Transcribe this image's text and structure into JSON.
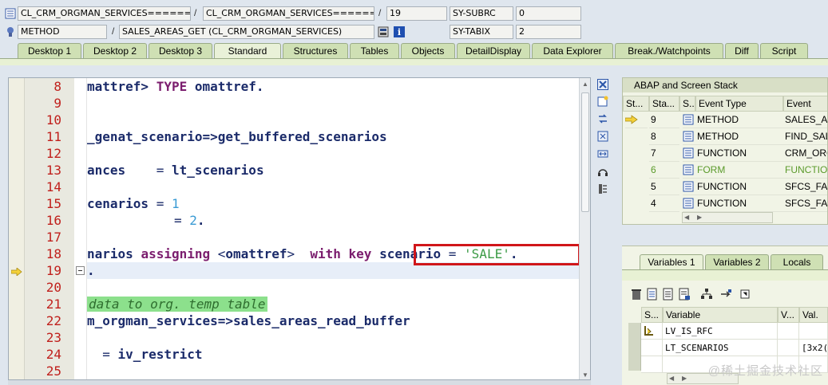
{
  "header": {
    "row1": {
      "field1": "CL_CRM_ORGMAN_SERVICES=======...",
      "sep1": "/",
      "field2": "CL_CRM_ORGMAN_SERVICES=======...",
      "sep2": "/",
      "line_no": "19",
      "sysvar_name": "SY-SUBRC",
      "sysvar_value": "0"
    },
    "row2": {
      "event_type": "METHOD",
      "sep1": "/",
      "event_name": "SALES_AREAS_GET (CL_CRM_ORGMAN_SERVICES)",
      "sysvar_name": "SY-TABIX",
      "sysvar_value": "2"
    }
  },
  "tabs": [
    "Desktop 1",
    "Desktop 2",
    "Desktop 3",
    "Standard",
    "Structures",
    "Tables",
    "Objects",
    "DetailDisplay",
    "Data Explorer",
    "Break./Watchpoints",
    "Diff",
    "Script"
  ],
  "active_tab": "Standard",
  "editor": {
    "lines": [
      {
        "n": "8"
      },
      {
        "n": "9"
      },
      {
        "n": "10"
      },
      {
        "n": "11"
      },
      {
        "n": "12"
      },
      {
        "n": "13"
      },
      {
        "n": "14"
      },
      {
        "n": "15"
      },
      {
        "n": "16"
      },
      {
        "n": "17"
      },
      {
        "n": "18"
      },
      {
        "n": "19"
      },
      {
        "n": "20"
      },
      {
        "n": "21"
      },
      {
        "n": "22"
      },
      {
        "n": "23"
      },
      {
        "n": "24"
      },
      {
        "n": "25"
      }
    ],
    "code": {
      "l8_a": "mattref> ",
      "l8_kw": "TYPE",
      "l8_b": " omattref.",
      "l11": "_genat_scenario=>get_buffered_scenarios",
      "l13_a": "ances    ",
      "l13_op": "=",
      "l13_b": " lt_scenarios",
      "l15_a": "cenarios ",
      "l15_op": "=",
      "l15_num": " 1",
      "l16_op": "=",
      "l16_num": " 2",
      "l16_dot": ".",
      "l18_a": "narios ",
      "l18_kw1": "assigning",
      "l18_lt": " <",
      "l18_b": "omattref",
      "l18_gt": ">",
      "l18_kw2": "  with key",
      "l18_c": " scenario ",
      "l18_op": "=",
      "l18_str": " 'SALE'",
      "l18_dot": ".",
      "l19": ".",
      "l21_cmt": "data to org. temp table",
      "l22": "m_orgman_services=>sales_areas_read_buffer",
      "l24_op": "  =",
      "l24_b": " iv_restrict"
    }
  },
  "stack": {
    "title": "ABAP and Screen Stack",
    "headers": [
      "St...",
      "Sta...",
      "S...",
      "Event Type",
      "Event"
    ],
    "rows": [
      {
        "status": "current",
        "level": "9",
        "type": "METHOD",
        "event": "SALES_AR",
        "color": "#000000"
      },
      {
        "status": "",
        "level": "8",
        "type": "METHOD",
        "event": "FIND_SAL",
        "color": "#000000"
      },
      {
        "status": "",
        "level": "7",
        "type": "FUNCTION",
        "event": "CRM_ORGI",
        "color": "#000000"
      },
      {
        "status": "",
        "level": "6",
        "type": "FORM",
        "event": "FUNCTION",
        "color": "#5a9a2a"
      },
      {
        "status": "",
        "level": "5",
        "type": "FUNCTION",
        "event": "SFCS_FA_",
        "color": "#000000"
      },
      {
        "status": "",
        "level": "4",
        "type": "FUNCTION",
        "event": "SFCS_FA_",
        "color": "#000000"
      }
    ]
  },
  "variables": {
    "tabs": [
      "Variables 1",
      "Variables 2",
      "Locals"
    ],
    "active_tab": "Variables 1",
    "headers": [
      "S...",
      "Variable",
      "V...",
      "Val."
    ],
    "rows": [
      {
        "variable": "LV_IS_RFC",
        "value": ""
      },
      {
        "variable": "LT_SCENARIOS",
        "value": "[3x2("
      }
    ]
  },
  "watermark": "@稀土掘金技术社区",
  "colors": {
    "line_number": "#c0201c",
    "keyword": "#7b1d6e",
    "number_literal": "#3a9bd4",
    "string_literal": "#3a9a44",
    "highlight_box": "#d0161a",
    "comment_bg": "#8ce08c"
  }
}
